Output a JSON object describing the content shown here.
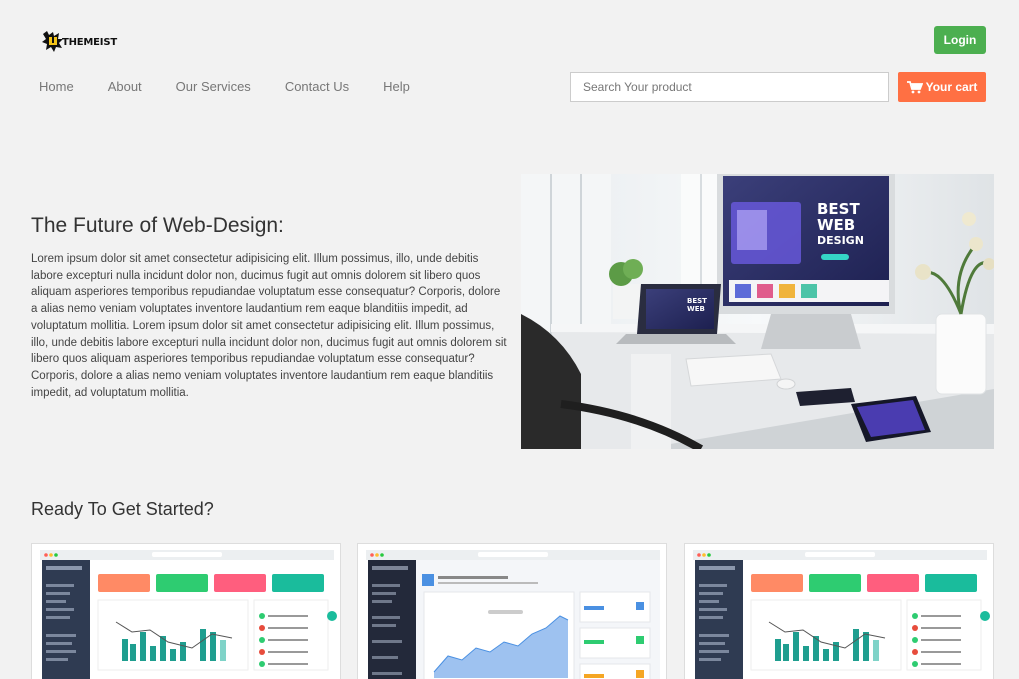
{
  "header": {
    "logo_text": "THEMEIST",
    "login_label": "Login",
    "nav": [
      "Home",
      "About",
      "Our Services",
      "Contact Us",
      "Help"
    ],
    "search_placeholder": "Search Your product",
    "cart_label": "Your cart"
  },
  "hero": {
    "title": "The Future of Web-Design:",
    "body": "Lorem ipsum dolor sit amet consectetur adipisicing elit. Illum possimus, illo, unde debitis labore excepturi nulla incidunt dolor non, ducimus fugit aut omnis dolorem sit libero quos aliquam asperiores temporibus repudiandae voluptatum esse consequatur? Corporis, dolore a alias nemo veniam voluptates inventore laudantium rem eaque blanditiis impedit, ad voluptatum mollitia. Lorem ipsum dolor sit amet consectetur adipisicing elit. Illum possimus, illo, unde debitis labore excepturi nulla incidunt dolor non, ducimus fugit aut omnis dolorem sit libero quos aliquam asperiores temporibus repudiandae voluptatum esse consequatur? Corporis, dolore a alias nemo veniam voluptates inventore laudantium rem eaque blanditiis impedit, ad voluptatum mollitia.",
    "image_monitor_text": [
      "BEST",
      "WEB",
      "DESIGN"
    ],
    "image_laptop_text": [
      "BEST",
      "WEB"
    ]
  },
  "templates": {
    "title": "Ready To Get Started?"
  },
  "colors": {
    "login": "#4caf50",
    "cart": "#ff7043",
    "background": "#f2f2f2"
  }
}
